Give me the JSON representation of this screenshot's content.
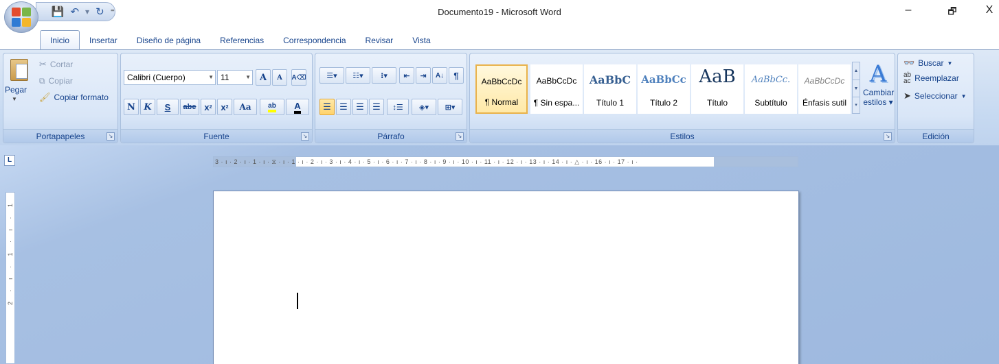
{
  "window": {
    "title": "Documento19 - Microsoft Word",
    "minimize": "–",
    "restore": "🗗",
    "close": "X"
  },
  "quick_access": {
    "customize": "⁼"
  },
  "tabs": [
    "Inicio",
    "Insertar",
    "Diseño de página",
    "Referencias",
    "Correspondencia",
    "Revisar",
    "Vista"
  ],
  "active_tab": "Inicio",
  "clipboard": {
    "group_label": "Portapapeles",
    "paste": "Pegar",
    "cut": "Cortar",
    "copy": "Copiar",
    "format_painter": "Copiar formato"
  },
  "font": {
    "group_label": "Fuente",
    "font_name": "Calibri (Cuerpo)",
    "font_size": "11",
    "grow": "A",
    "shrink": "A",
    "bold": "N",
    "italic": "K",
    "underline": "S",
    "strikethrough": "abe",
    "subscript": "x",
    "superscript": "x",
    "change_case": "Aa",
    "highlight": "ab",
    "font_color": "A"
  },
  "paragraph": {
    "group_label": "Párrafo",
    "show_marks": "¶",
    "sort": "A↓"
  },
  "styles": {
    "group_label": "Estilos",
    "items": [
      {
        "sample": "AaBbCcDc",
        "name": "¶ Normal"
      },
      {
        "sample": "AaBbCcDc",
        "name": "¶ Sin espa..."
      },
      {
        "sample": "AaBbC",
        "name": "Título 1"
      },
      {
        "sample": "AaBbCc",
        "name": "Título 2"
      },
      {
        "sample": "AaB",
        "name": "Título"
      },
      {
        "sample": "AaBbCc.",
        "name": "Subtítulo"
      },
      {
        "sample": "AaBbCcDc",
        "name": "Énfasis sutil"
      }
    ],
    "change_styles": "Cambiar",
    "change_styles_2": "estilos"
  },
  "editing": {
    "group_label": "Edición",
    "find": "Buscar",
    "replace": "Reemplazar",
    "select": "Seleccionar"
  },
  "ruler": {
    "corner": "L",
    "text": "3 · ı · 2 · ı · 1 · ı · ⧖ · ı · 1 · ı · 2 · ı · 3 · ı · 4 · ı · 5 · ı · 6 · ı · 7 · ı · 8 · ı · 9 · ı · 10 · ı · 11 · ı · 12 · ı · 13 · ı · 14 · ı · △ · ı · 16 · ı · 17 · ı ·",
    "vertical_text": "2 · ı · 1 · ı · 1"
  },
  "colors": {
    "ribbon_bg": "#c6d9f1",
    "label_text": "#15428b",
    "selected_style_border": "#e9b24a",
    "workspace_bg": "#9eb9df"
  }
}
